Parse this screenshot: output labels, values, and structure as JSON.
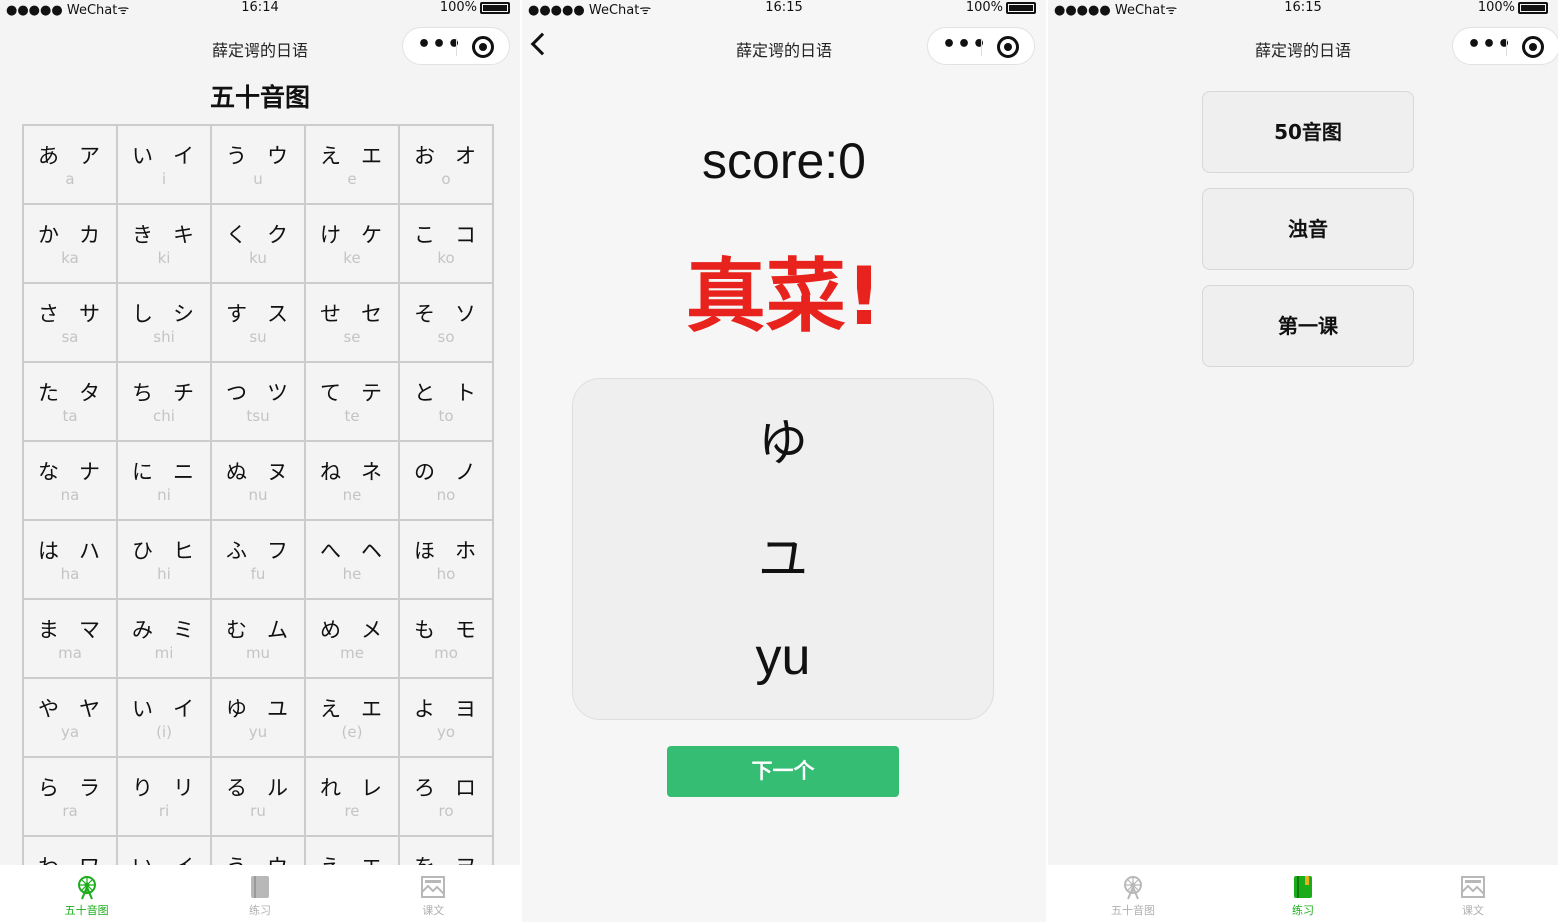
{
  "status": {
    "carrier": "●●●●● WeChat",
    "wifi": "ᯤ",
    "battery": "100%"
  },
  "screen1": {
    "time": "16:14",
    "nav_title": "薛定谔的日语",
    "page_title": "五十音图",
    "kana": [
      {
        "h": "あ",
        "k": "ア",
        "r": "a"
      },
      {
        "h": "い",
        "k": "イ",
        "r": "i"
      },
      {
        "h": "う",
        "k": "ウ",
        "r": "u"
      },
      {
        "h": "え",
        "k": "エ",
        "r": "e"
      },
      {
        "h": "お",
        "k": "オ",
        "r": "o"
      },
      {
        "h": "か",
        "k": "カ",
        "r": "ka"
      },
      {
        "h": "き",
        "k": "キ",
        "r": "ki"
      },
      {
        "h": "く",
        "k": "ク",
        "r": "ku"
      },
      {
        "h": "け",
        "k": "ケ",
        "r": "ke"
      },
      {
        "h": "こ",
        "k": "コ",
        "r": "ko"
      },
      {
        "h": "さ",
        "k": "サ",
        "r": "sa"
      },
      {
        "h": "し",
        "k": "シ",
        "r": "shi"
      },
      {
        "h": "す",
        "k": "ス",
        "r": "su"
      },
      {
        "h": "せ",
        "k": "セ",
        "r": "se"
      },
      {
        "h": "そ",
        "k": "ソ",
        "r": "so"
      },
      {
        "h": "た",
        "k": "タ",
        "r": "ta"
      },
      {
        "h": "ち",
        "k": "チ",
        "r": "chi"
      },
      {
        "h": "つ",
        "k": "ツ",
        "r": "tsu"
      },
      {
        "h": "て",
        "k": "テ",
        "r": "te"
      },
      {
        "h": "と",
        "k": "ト",
        "r": "to"
      },
      {
        "h": "な",
        "k": "ナ",
        "r": "na"
      },
      {
        "h": "に",
        "k": "ニ",
        "r": "ni"
      },
      {
        "h": "ぬ",
        "k": "ヌ",
        "r": "nu"
      },
      {
        "h": "ね",
        "k": "ネ",
        "r": "ne"
      },
      {
        "h": "の",
        "k": "ノ",
        "r": "no"
      },
      {
        "h": "は",
        "k": "ハ",
        "r": "ha"
      },
      {
        "h": "ひ",
        "k": "ヒ",
        "r": "hi"
      },
      {
        "h": "ふ",
        "k": "フ",
        "r": "fu"
      },
      {
        "h": "へ",
        "k": "ヘ",
        "r": "he"
      },
      {
        "h": "ほ",
        "k": "ホ",
        "r": "ho"
      },
      {
        "h": "ま",
        "k": "マ",
        "r": "ma"
      },
      {
        "h": "み",
        "k": "ミ",
        "r": "mi"
      },
      {
        "h": "む",
        "k": "ム",
        "r": "mu"
      },
      {
        "h": "め",
        "k": "メ",
        "r": "me"
      },
      {
        "h": "も",
        "k": "モ",
        "r": "mo"
      },
      {
        "h": "や",
        "k": "ヤ",
        "r": "ya"
      },
      {
        "h": "い",
        "k": "イ",
        "r": "(i)"
      },
      {
        "h": "ゆ",
        "k": "ユ",
        "r": "yu"
      },
      {
        "h": "え",
        "k": "エ",
        "r": "(e)"
      },
      {
        "h": "よ",
        "k": "ヨ",
        "r": "yo"
      },
      {
        "h": "ら",
        "k": "ラ",
        "r": "ra"
      },
      {
        "h": "り",
        "k": "リ",
        "r": "ri"
      },
      {
        "h": "る",
        "k": "ル",
        "r": "ru"
      },
      {
        "h": "れ",
        "k": "レ",
        "r": "re"
      },
      {
        "h": "ろ",
        "k": "ロ",
        "r": "ro"
      },
      {
        "h": "わ",
        "k": "ワ",
        "r": ""
      },
      {
        "h": "い",
        "k": "イ",
        "r": ""
      },
      {
        "h": "う",
        "k": "ウ",
        "r": ""
      },
      {
        "h": "え",
        "k": "エ",
        "r": ""
      },
      {
        "h": "を",
        "k": "ヲ",
        "r": ""
      }
    ],
    "tabs": [
      {
        "label": "五十音图",
        "icon": "ferris-wheel-icon",
        "active": true
      },
      {
        "label": "练习",
        "icon": "book-icon",
        "active": false
      },
      {
        "label": "课文",
        "icon": "picture-icon",
        "active": false
      }
    ]
  },
  "screen2": {
    "time": "16:15",
    "nav_title": "薛定谔的日语",
    "score": "score:0",
    "result": "真菜!",
    "hiragana": "ゆ",
    "katakana": "ユ",
    "romaji": "yu",
    "next_label": "下一个"
  },
  "screen3": {
    "time": "16:15",
    "nav_title": "薛定谔的日语",
    "menu": [
      "50音图",
      "浊音",
      "第一课"
    ],
    "tabs": [
      {
        "label": "五十音图",
        "icon": "ferris-wheel-icon",
        "active": false
      },
      {
        "label": "练习",
        "icon": "book-icon",
        "active": true
      },
      {
        "label": "课文",
        "icon": "picture-icon",
        "active": false
      }
    ]
  },
  "colors": {
    "accent_green": "#1aad19",
    "button_green": "#35bd74",
    "result_red": "#e8221c"
  }
}
